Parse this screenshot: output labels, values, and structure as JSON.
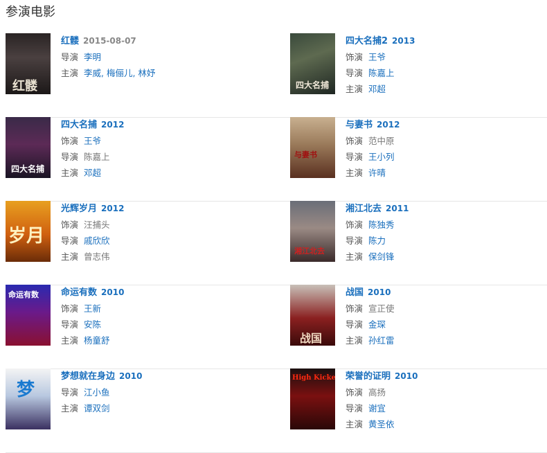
{
  "section_title": "参演电影",
  "films": [
    {
      "title": "红髅",
      "year": "2015-08-07",
      "meta": [
        {
          "label": "导演",
          "items": [
            {
              "t": "李明",
              "link": true
            }
          ]
        },
        {
          "label": "主演",
          "items": [
            {
              "t": "李威, 梅俪儿, 林妤",
              "link": true
            }
          ]
        }
      ]
    },
    {
      "title": "四大名捕2",
      "year": "2013",
      "meta": [
        {
          "label": "饰演",
          "items": [
            {
              "t": "王爷",
              "link": true
            }
          ]
        },
        {
          "label": "导演",
          "items": [
            {
              "t": "陈嘉上",
              "link": true
            }
          ]
        },
        {
          "label": "主演",
          "items": [
            {
              "t": "邓超",
              "link": true
            }
          ]
        }
      ]
    },
    {
      "title": "四大名捕",
      "year": "2012",
      "meta": [
        {
          "label": "饰演",
          "items": [
            {
              "t": "王爷",
              "link": true
            }
          ]
        },
        {
          "label": "导演",
          "items": [
            {
              "t": "陈嘉上",
              "link": false
            }
          ]
        },
        {
          "label": "主演",
          "items": [
            {
              "t": "邓超",
              "link": true
            }
          ]
        }
      ]
    },
    {
      "title": "与妻书",
      "year": "2012",
      "meta": [
        {
          "label": "饰演",
          "items": [
            {
              "t": "范中原",
              "link": false
            }
          ]
        },
        {
          "label": "导演",
          "items": [
            {
              "t": "王小列",
              "link": true
            }
          ]
        },
        {
          "label": "主演",
          "items": [
            {
              "t": "许晴",
              "link": true
            }
          ]
        }
      ]
    },
    {
      "title": "光辉岁月",
      "year": "2012",
      "meta": [
        {
          "label": "饰演",
          "items": [
            {
              "t": "汪捕头",
              "link": false
            }
          ]
        },
        {
          "label": "导演",
          "items": [
            {
              "t": "戚欣欣",
              "link": true
            }
          ]
        },
        {
          "label": "主演",
          "items": [
            {
              "t": "曾志伟",
              "link": false
            }
          ]
        }
      ]
    },
    {
      "title": "湘江北去",
      "year": "2011",
      "meta": [
        {
          "label": "饰演",
          "items": [
            {
              "t": "陈独秀",
              "link": true
            }
          ]
        },
        {
          "label": "导演",
          "items": [
            {
              "t": "陈力",
              "link": true
            }
          ]
        },
        {
          "label": "主演",
          "items": [
            {
              "t": "保剑锋",
              "link": true
            }
          ]
        }
      ]
    },
    {
      "title": "命运有数",
      "year": "2010",
      "meta": [
        {
          "label": "饰演",
          "items": [
            {
              "t": "王新",
              "link": true
            }
          ]
        },
        {
          "label": "导演",
          "items": [
            {
              "t": "安陈",
              "link": true
            }
          ]
        },
        {
          "label": "主演",
          "items": [
            {
              "t": "杨童舒",
              "link": true
            }
          ]
        }
      ]
    },
    {
      "title": "战国",
      "year": "2010",
      "meta": [
        {
          "label": "饰演",
          "items": [
            {
              "t": "宣正使",
              "link": false
            }
          ]
        },
        {
          "label": "导演",
          "items": [
            {
              "t": "金琛",
              "link": true
            }
          ]
        },
        {
          "label": "主演",
          "items": [
            {
              "t": "孙红雷",
              "link": true
            }
          ]
        }
      ]
    },
    {
      "title": "梦想就在身边",
      "year": "2010",
      "meta": [
        {
          "label": "导演",
          "items": [
            {
              "t": "江小鱼",
              "link": true
            }
          ]
        },
        {
          "label": "主演",
          "items": [
            {
              "t": "谭双剑",
              "link": true
            }
          ]
        }
      ]
    },
    {
      "title": "荣誉的证明",
      "year": "2010",
      "meta": [
        {
          "label": "饰演",
          "items": [
            {
              "t": "高扬",
              "link": false
            }
          ]
        },
        {
          "label": "导演",
          "items": [
            {
              "t": "谢宜",
              "link": true
            }
          ]
        },
        {
          "label": "主演",
          "items": [
            {
              "t": "黄圣依",
              "link": true
            }
          ]
        }
      ]
    }
  ],
  "poster_texts": {
    "p0": "红髅",
    "p1": "四大名捕",
    "p2": "四大名捕",
    "p3": "与妻书",
    "p4": "岁月",
    "p5": "湘江北去",
    "p6": "命运有数",
    "p7": "战国",
    "p8": "梦",
    "p9": "High Kickers"
  }
}
